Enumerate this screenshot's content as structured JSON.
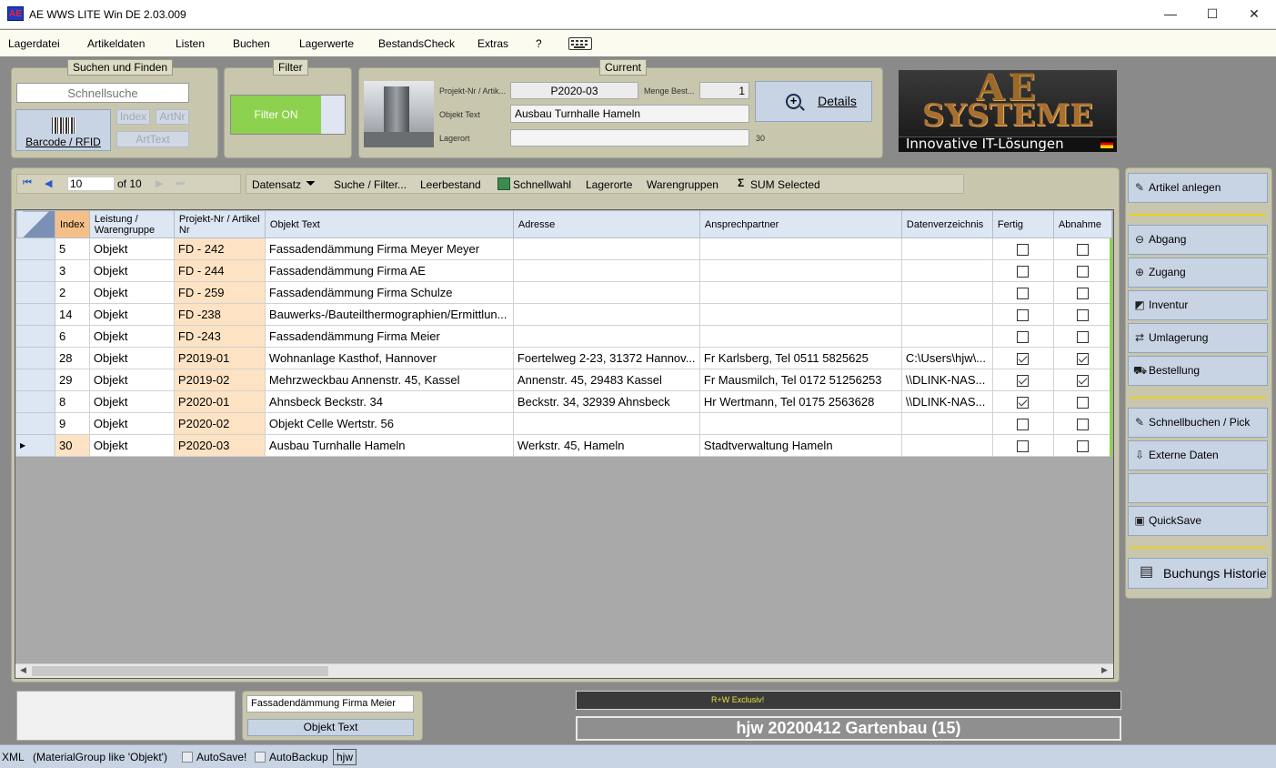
{
  "window": {
    "icon_text": "AE",
    "title": "AE WWS LITE Win DE 2.03.009",
    "minimize": "—",
    "maximize": "☐",
    "close": "✕"
  },
  "menu": [
    "Lagerdatei",
    "Artikeldaten",
    "Listen",
    "Buchen",
    "Lagerwerte",
    "BestandsCheck",
    "Extras",
    "?"
  ],
  "search": {
    "title": "Suchen und Finden",
    "placeholder": "Schnellsuche",
    "barcode_label": "Barcode / RFID",
    "index": "Index",
    "artnr": "ArtNr",
    "arttext": "ArtText"
  },
  "filter": {
    "title": "Filter",
    "button": "Filter ON"
  },
  "current": {
    "title": "Current",
    "projekt_label": "Projekt-Nr / Artik...",
    "projekt_value": "P2020-03",
    "menge_label": "Menge Best...",
    "menge_value": "1",
    "objekt_label": "Objekt Text",
    "objekt_value": "Ausbau Turnhalle Hameln",
    "lagerort_label": "Lagerort",
    "lagerort_value": "",
    "lagerort_count": "30",
    "details": "Details"
  },
  "logo": {
    "line1": "AE",
    "line2": "SYSTEME",
    "tagline": "Innovative IT-Lösungen"
  },
  "nav": {
    "position": "10",
    "of": "of 10"
  },
  "toolbar": [
    "Datensatz",
    "Suche / Filter...",
    "Leerbestand",
    "Schnellwahl",
    "Lagerorte",
    "Warengruppen",
    "SUM Selected"
  ],
  "columns": [
    "Index",
    "Leistung / Warengruppe",
    "Projekt-Nr / Artikel Nr",
    "Objekt Text",
    "Adresse",
    "Ansprechpartner",
    "Datenverzeichnis",
    "Fertig",
    "Abnahme"
  ],
  "rows": [
    {
      "index": "5",
      "gruppe": "Objekt",
      "projekt": "FD - 242",
      "text": "Fassadendämmung Firma Meyer Meyer",
      "adresse": "",
      "ansprech": "",
      "dir": "",
      "fertig": false,
      "abnahme": false
    },
    {
      "index": "3",
      "gruppe": "Objekt",
      "projekt": "FD - 244",
      "text": "Fassadendämmung Firma AE",
      "adresse": "",
      "ansprech": "",
      "dir": "",
      "fertig": false,
      "abnahme": false
    },
    {
      "index": "2",
      "gruppe": "Objekt",
      "projekt": "FD - 259",
      "text": "Fassadendämmung Firma Schulze",
      "adresse": "",
      "ansprech": "",
      "dir": "",
      "fertig": false,
      "abnahme": false
    },
    {
      "index": "14",
      "gruppe": "Objekt",
      "projekt": "FD -238",
      "text": "Bauwerks-/Bauteilthermographien/Ermittlun...",
      "adresse": "",
      "ansprech": "",
      "dir": "",
      "fertig": false,
      "abnahme": false
    },
    {
      "index": "6",
      "gruppe": "Objekt",
      "projekt": "FD -243",
      "text": "Fassadendämmung Firma Meier",
      "adresse": "",
      "ansprech": "",
      "dir": "",
      "fertig": false,
      "abnahme": false
    },
    {
      "index": "28",
      "gruppe": "Objekt",
      "projekt": "P2019-01",
      "text": "Wohnanlage Kasthof, Hannover",
      "adresse": "Foertelweg 2-23, 31372 Hannov...",
      "ansprech": "Fr Karlsberg, Tel 0511 5825625",
      "dir": "C:\\Users\\hjw\\...",
      "fertig": true,
      "abnahme": true
    },
    {
      "index": "29",
      "gruppe": "Objekt",
      "projekt": "P2019-02",
      "text": "Mehrzweckbau Annenstr. 45, Kassel",
      "adresse": "Annenstr. 45, 29483 Kassel",
      "ansprech": "Fr Mausmilch, Tel 0172 51256253",
      "dir": "\\\\DLINK-NAS...",
      "fertig": true,
      "abnahme": true
    },
    {
      "index": "8",
      "gruppe": "Objekt",
      "projekt": "P2020-01",
      "text": "Ahnsbeck Beckstr. 34",
      "adresse": "Beckstr. 34, 32939 Ahnsbeck",
      "ansprech": "Hr Wertmann, Tel 0175 2563628",
      "dir": "\\\\DLINK-NAS...",
      "fertig": true,
      "abnahme": false
    },
    {
      "index": "9",
      "gruppe": "Objekt",
      "projekt": "P2020-02",
      "text": "Objekt Celle Wertstr. 56",
      "adresse": "",
      "ansprech": "",
      "dir": "",
      "fertig": false,
      "abnahme": false
    },
    {
      "index": "30",
      "gruppe": "Objekt",
      "projekt": "P2020-03",
      "text": "Ausbau Turnhalle Hameln",
      "adresse": "Werkstr. 45, Hameln",
      "ansprech": "Stadtverwaltung Hameln",
      "dir": "",
      "fertig": false,
      "abnahme": false,
      "current": true
    }
  ],
  "side": {
    "artikel_anlegen": "Artikel anlegen",
    "abgang": "Abgang",
    "zugang": "Zugang",
    "inventur": "Inventur",
    "umlagerung": "Umlagerung",
    "bestellung": "Bestellung",
    "schnellbuchen": "Schnellbuchen / Pick List",
    "externe": "Externe Daten",
    "quicksave": "QuickSave",
    "historie": "Buchungs Historie"
  },
  "bottom": {
    "text_value": "Fassadendämmung Firma Meier",
    "text_button": "Objekt Text",
    "exclusive": "R+W Exclusiv!",
    "db_name": "hjw 20200412 Gartenbau (15)"
  },
  "status": {
    "xml": "XML",
    "filter": "(MaterialGroup like 'Objekt')",
    "autosave": "AutoSave!",
    "autobackup": "AutoBackup",
    "user": "hjw"
  },
  "colors": {
    "accent_yellow": "#e8d020",
    "filter_green": "#8cd24e",
    "project_col": "#fde3c3"
  }
}
